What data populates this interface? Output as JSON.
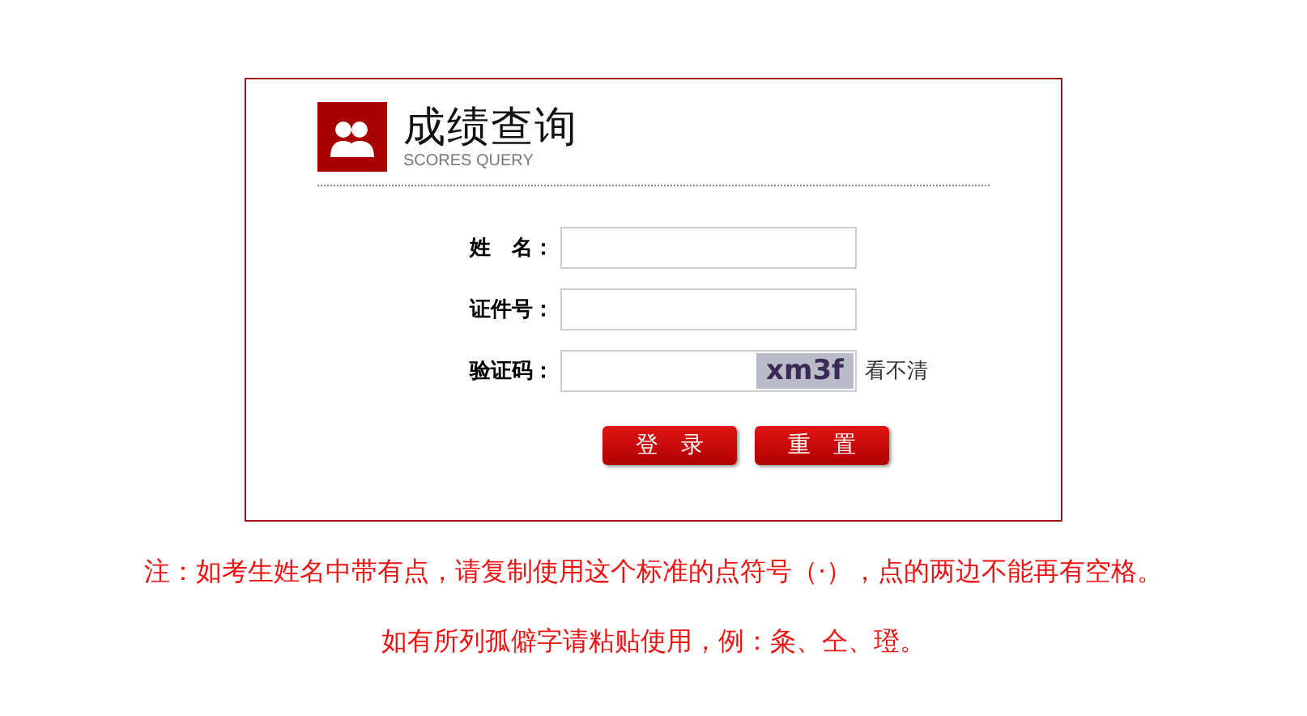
{
  "header": {
    "title": "成绩查询",
    "subtitle": "SCORES QUERY"
  },
  "fields": [
    {
      "label": "姓　名：",
      "kind": "text"
    },
    {
      "label": "证件号：",
      "kind": "text"
    },
    {
      "label": "验证码：",
      "kind": "captcha",
      "captcha": "xm3f",
      "refresh": "看不清"
    }
  ],
  "buttons": [
    "登　录",
    "重　置"
  ],
  "notes": [
    "注：如考生姓名中带有点，请复制使用这个标准的点符号（·），点的两边不能再有空格。",
    "如有所列孤僻字请粘贴使用，例：粂、仝、璒。"
  ]
}
